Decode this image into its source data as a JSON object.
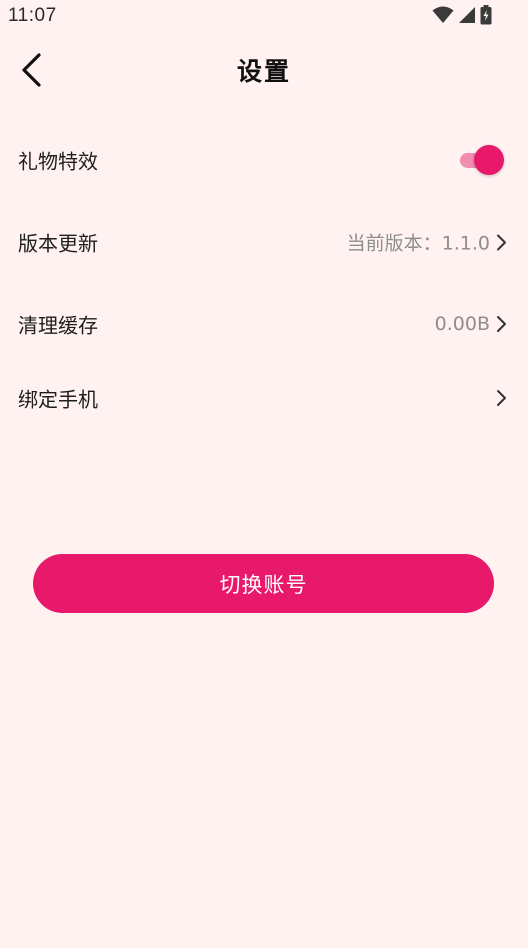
{
  "status_bar": {
    "time": "11:07",
    "icons": [
      "wifi-icon",
      "signal-icon",
      "battery-charging-icon"
    ]
  },
  "header": {
    "title": "设置",
    "back_icon": "chevron-left-icon"
  },
  "settings": {
    "gift_effects": {
      "label": "礼物特效",
      "enabled": true
    },
    "version_update": {
      "label": "版本更新",
      "value": "当前版本：1.1.0"
    },
    "clear_cache": {
      "label": "清理缓存",
      "value": "0.00B"
    },
    "bind_phone": {
      "label": "绑定手机"
    }
  },
  "actions": {
    "switch_account": "切换账号"
  },
  "colors": {
    "accent": "#e8196a",
    "toggle_track": "#f08db0",
    "background": "#fff2f1",
    "secondary_text": "#8e8e8e"
  }
}
